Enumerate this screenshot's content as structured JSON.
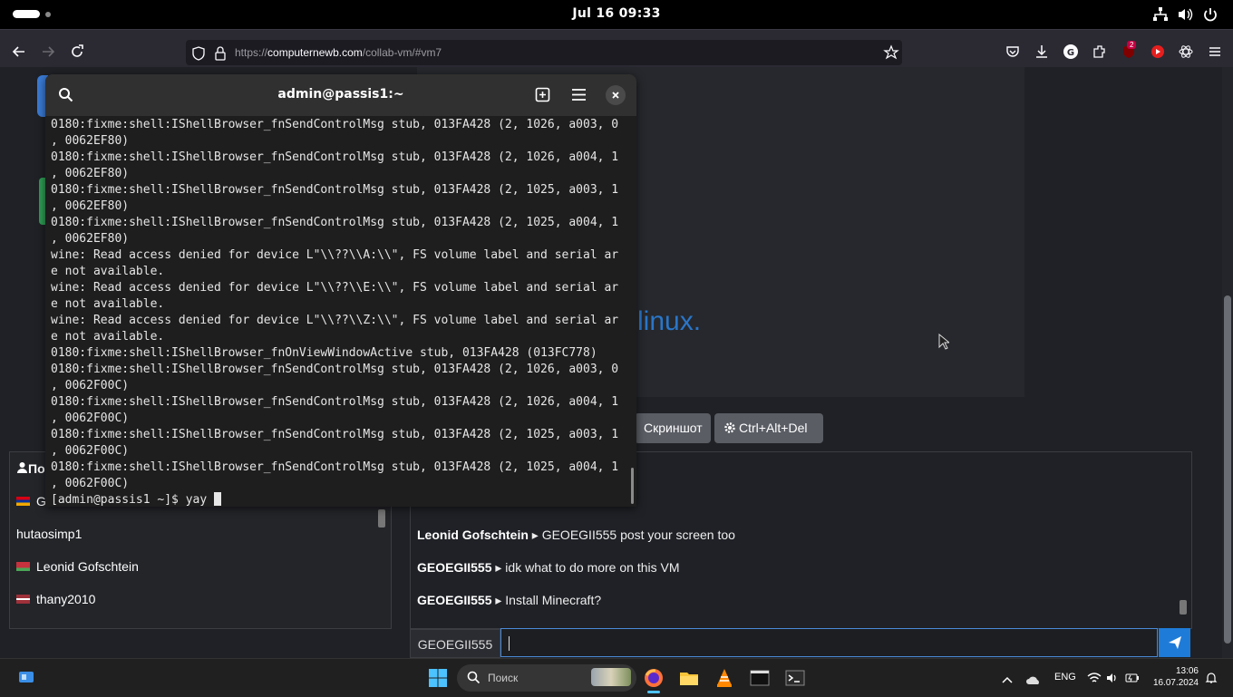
{
  "topbar": {
    "clock": "Jul 16  09:33"
  },
  "browser": {
    "url_prefix": "https://",
    "url_domain": "computernewb.com",
    "url_path": "/collab-vm/#vm7",
    "badge_count": "2"
  },
  "vm": {
    "distro_text": "linux.",
    "screenshot_label": "Скриншот",
    "ctrl_alt_del_label": "Ctrl+Alt+Del"
  },
  "users": {
    "header": "По",
    "list": [
      {
        "name": "G",
        "flag": "armenia"
      },
      {
        "name": "hutaosimp1",
        "flag": "none"
      },
      {
        "name": "Leonid Gofschtein",
        "flag": "belarus"
      },
      {
        "name": "thany2010",
        "flag": "latvia"
      }
    ]
  },
  "chat": {
    "messages": [
      {
        "user": "Leonid Gofschtein",
        "text": "GEOEGII555 post your screen too"
      },
      {
        "user": "GEOEGII555",
        "text": "idk what to do more on this VM"
      },
      {
        "user": "GEOEGII555",
        "text": "Install Minecraft?"
      }
    ],
    "nickname": "GEOEGII555",
    "input_value": ""
  },
  "terminal": {
    "title": "admin@passis1:~",
    "output": "0180:fixme:shell:IShellBrowser_fnSendControlMsg stub, 013FA428 (2, 1026, a003, 0\n, 0062EF80)\n0180:fixme:shell:IShellBrowser_fnSendControlMsg stub, 013FA428 (2, 1026, a004, 1\n, 0062EF80)\n0180:fixme:shell:IShellBrowser_fnSendControlMsg stub, 013FA428 (2, 1025, a003, 1\n, 0062EF80)\n0180:fixme:shell:IShellBrowser_fnSendControlMsg stub, 013FA428 (2, 1025, a004, 1\n, 0062EF80)\nwine: Read access denied for device L\"\\\\??\\\\A:\\\\\", FS volume label and serial ar\ne not available.\nwine: Read access denied for device L\"\\\\??\\\\E:\\\\\", FS volume label and serial ar\ne not available.\nwine: Read access denied for device L\"\\\\??\\\\Z:\\\\\", FS volume label and serial ar\ne not available.\n0180:fixme:shell:IShellBrowser_fnOnViewWindowActive stub, 013FA428 (013FC778)\n0180:fixme:shell:IShellBrowser_fnSendControlMsg stub, 013FA428 (2, 1026, a003, 0\n, 0062F00C)\n0180:fixme:shell:IShellBrowser_fnSendControlMsg stub, 013FA428 (2, 1026, a004, 1\n, 0062F00C)\n0180:fixme:shell:IShellBrowser_fnSendControlMsg stub, 013FA428 (2, 1025, a003, 1\n, 0062F00C)\n0180:fixme:shell:IShellBrowser_fnSendControlMsg stub, 013FA428 (2, 1025, a004, 1\n, 0062F00C)",
    "prompt": "[admin@passis1 ~]$ yay "
  },
  "taskbar": {
    "search_placeholder": "Поиск",
    "lang": "ENG",
    "time": "13:06",
    "date": "16.07.2024"
  },
  "colors": {
    "accent": "#1f7bd8",
    "terminal_bg": "#1e1e1e",
    "topbar_bg": "#000000"
  }
}
